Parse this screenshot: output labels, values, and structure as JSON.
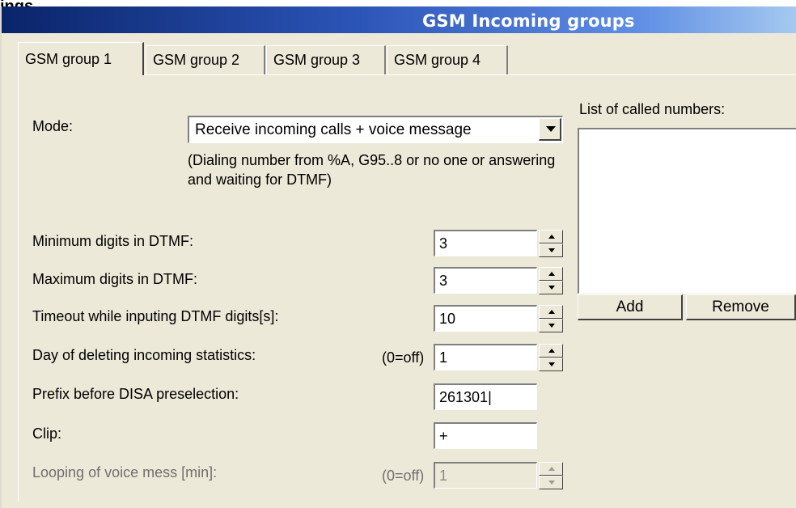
{
  "window": {
    "title": "GSM Incoming groups",
    "top_label": "ings"
  },
  "tabs": [
    {
      "label": "GSM group 1",
      "active": true
    },
    {
      "label": "GSM group 2",
      "active": false
    },
    {
      "label": "GSM group 3",
      "active": false
    },
    {
      "label": "GSM group 4",
      "active": false
    }
  ],
  "mode": {
    "label": "Mode:",
    "value": "Receive incoming calls + voice message",
    "description": "(Dialing number from %A, G95..8 or no one or answering and waiting for DTMF)"
  },
  "called_numbers": {
    "label": "List of called numbers:",
    "items": [],
    "add_label": "Add",
    "remove_label": "Remove"
  },
  "fields": {
    "min_digits": {
      "label": "Minimum digits in DTMF:",
      "value": "3"
    },
    "max_digits": {
      "label": "Maximum digits in DTMF:",
      "value": "3"
    },
    "timeout": {
      "label": "Timeout while inputing DTMF digits[s]:",
      "value": "10"
    },
    "delete_day": {
      "label": "Day of deleting incoming statistics:",
      "hint": "(0=off)",
      "value": "1"
    },
    "prefix": {
      "label": "Prefix before DISA preselection:",
      "value": "261301|"
    },
    "clip": {
      "label": "Clip:",
      "value": "+"
    },
    "looping": {
      "label": "Looping of voice mess [min]:",
      "hint": "(0=off)",
      "value": "1",
      "disabled": true
    }
  }
}
